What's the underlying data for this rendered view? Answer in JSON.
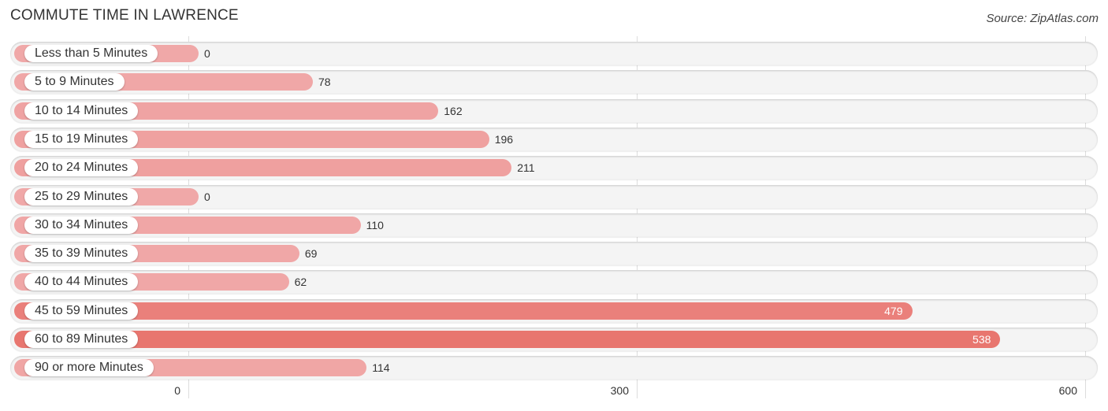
{
  "title": "COMMUTE TIME IN LAWRENCE",
  "source": "Source: ZipAtlas.com",
  "chart_data": {
    "type": "bar",
    "orientation": "horizontal",
    "title": "COMMUTE TIME IN LAWRENCE",
    "xlabel": "",
    "ylabel": "",
    "xlim": [
      0,
      600
    ],
    "xticks": [
      0,
      300,
      600
    ],
    "xtick_labels": [
      "0",
      "300",
      "600"
    ],
    "grid": true,
    "categories": [
      "Less than 5 Minutes",
      "5 to 9 Minutes",
      "10 to 14 Minutes",
      "15 to 19 Minutes",
      "20 to 24 Minutes",
      "25 to 29 Minutes",
      "30 to 34 Minutes",
      "35 to 39 Minutes",
      "40 to 44 Minutes",
      "45 to 59 Minutes",
      "60 to 89 Minutes",
      "90 or more Minutes"
    ],
    "values": [
      0,
      78,
      162,
      196,
      211,
      0,
      110,
      69,
      62,
      479,
      538,
      114
    ],
    "colors": {
      "light": "#f0a8a8",
      "dark": "#e8766f",
      "track": "#f4f4f4"
    }
  }
}
